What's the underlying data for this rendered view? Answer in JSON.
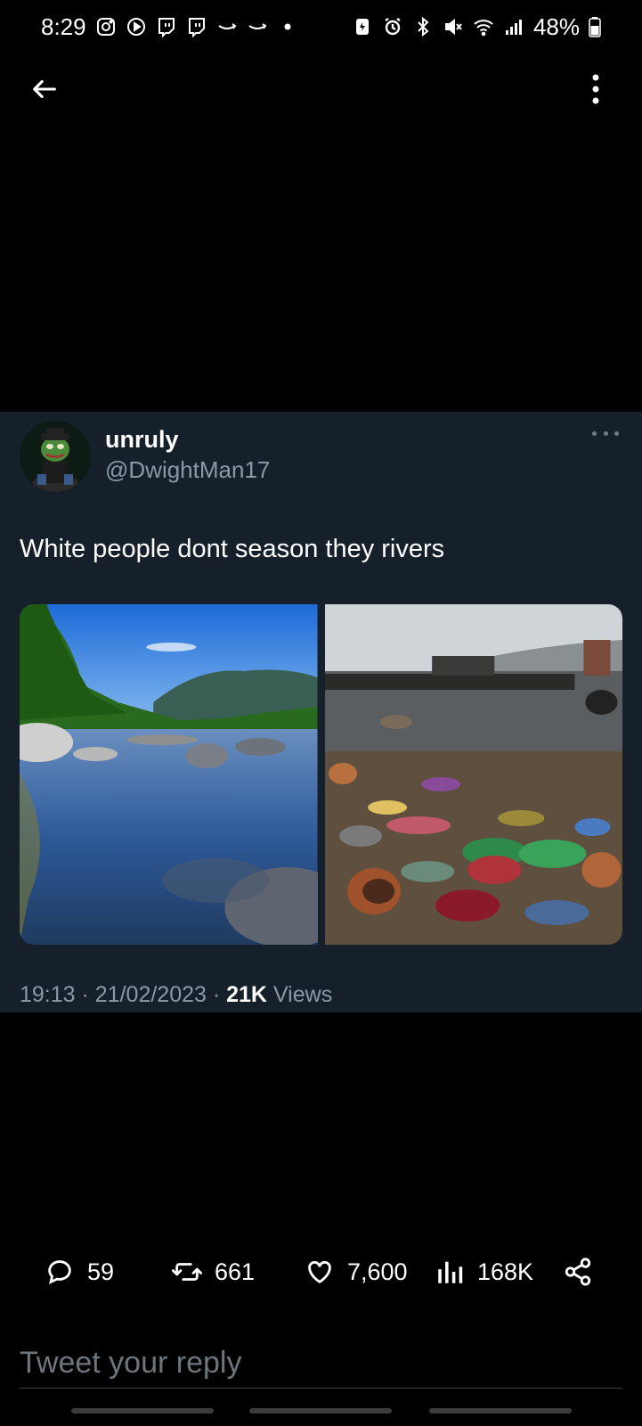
{
  "status_bar": {
    "time": "8:29",
    "battery": "48%",
    "left_icons": [
      "instagram-icon",
      "play-icon",
      "twitch-icon",
      "twitch-icon",
      "amazon-icon",
      "amazon-icon",
      "dot-icon"
    ],
    "right_icons": [
      "battery-saver-icon",
      "alarm-icon",
      "bluetooth-icon",
      "mute-icon",
      "wifi-icon",
      "signal-icon",
      "battery-icon"
    ]
  },
  "nav": {
    "back_icon": "arrow-left-icon",
    "more_icon": "vertical-dots-icon"
  },
  "tweet": {
    "display_name": "unruly",
    "handle": "@DwightMan17",
    "text": "White people dont season they rivers",
    "time": "19:13",
    "date": "21/02/2023",
    "views_count": "21K",
    "views_label": "Views"
  },
  "actions": {
    "replies": "59",
    "retweets": "661",
    "likes": "7,600",
    "views": "168K"
  },
  "reply": {
    "placeholder": "Tweet your reply"
  },
  "colors": {
    "card_bg": "#15202b",
    "secondary_text": "#8b98a5",
    "page_bg": "#000000"
  }
}
